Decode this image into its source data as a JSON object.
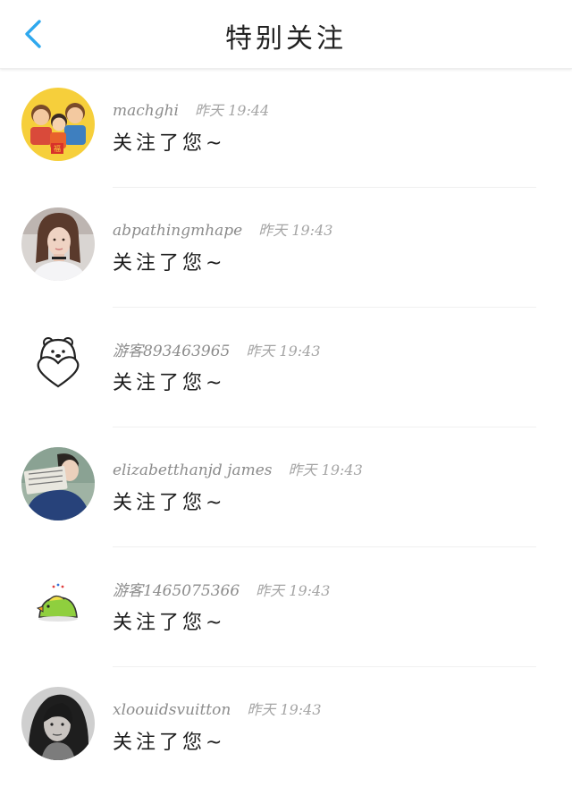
{
  "header": {
    "title": "特别关注",
    "back_icon": "chevron-left-icon",
    "accent_color": "#2ea8ee"
  },
  "notifications": [
    {
      "username": "machghi",
      "time": "昨天 19:44",
      "message": "关注了您~",
      "avatar": "cartoon-family-avatar"
    },
    {
      "username": "abpathingmhape",
      "time": "昨天 19:43",
      "message": "关注了您~",
      "avatar": "girl-photo-avatar"
    },
    {
      "username": "游客893463965",
      "time": "昨天 19:43",
      "message": "关注了您~",
      "avatar": "bear-heart-icon"
    },
    {
      "username": "elizabetthanjd james",
      "time": "昨天 19:43",
      "message": "关注了您~",
      "avatar": "reading-boy-avatar"
    },
    {
      "username": "游客1465075366",
      "time": "昨天 19:43",
      "message": "关注了您~",
      "avatar": "green-bird-icon"
    },
    {
      "username": "xloouidsvuitton",
      "time": "昨天 19:43",
      "message": "关注了您~",
      "avatar": "woman-bw-photo-avatar"
    }
  ]
}
